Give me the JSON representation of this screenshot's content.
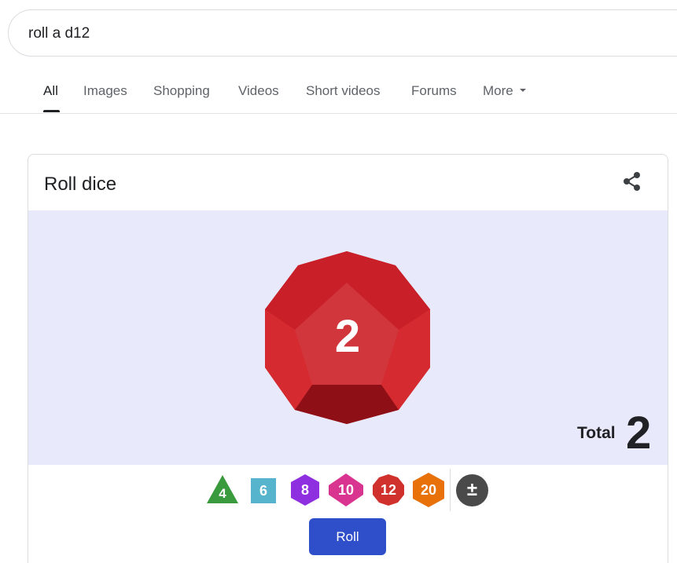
{
  "search": {
    "query": "roll a d12"
  },
  "tabs": [
    {
      "label": "All",
      "active": true
    },
    {
      "label": "Images"
    },
    {
      "label": "Shopping"
    },
    {
      "label": "Videos"
    },
    {
      "label": "Short videos"
    },
    {
      "label": "Forums"
    },
    {
      "label": "More"
    }
  ],
  "card": {
    "title": "Roll dice",
    "share_icon": "share-icon",
    "rolled_value": "2",
    "total_label": "Total",
    "total_value": "2",
    "dice_buttons": [
      {
        "label": "4",
        "shape": "triangle",
        "color": "#3a9a3e"
      },
      {
        "label": "6",
        "shape": "square",
        "color": "#56b4cc"
      },
      {
        "label": "8",
        "shape": "hexagon",
        "color": "#8e2fe0"
      },
      {
        "label": "10",
        "shape": "diamond",
        "color": "#d93590"
      },
      {
        "label": "12",
        "shape": "decagon",
        "color": "#d0312d"
      },
      {
        "label": "20",
        "shape": "hexagon",
        "color": "#e8710a"
      },
      {
        "label": "±",
        "shape": "circle",
        "color": "#4a4a4a"
      }
    ],
    "roll_button": "Roll"
  },
  "colors": {
    "dice_area_bg": "#e8eafc",
    "d12_body": "#d42a2f",
    "roll_button": "#2f4ec9"
  }
}
